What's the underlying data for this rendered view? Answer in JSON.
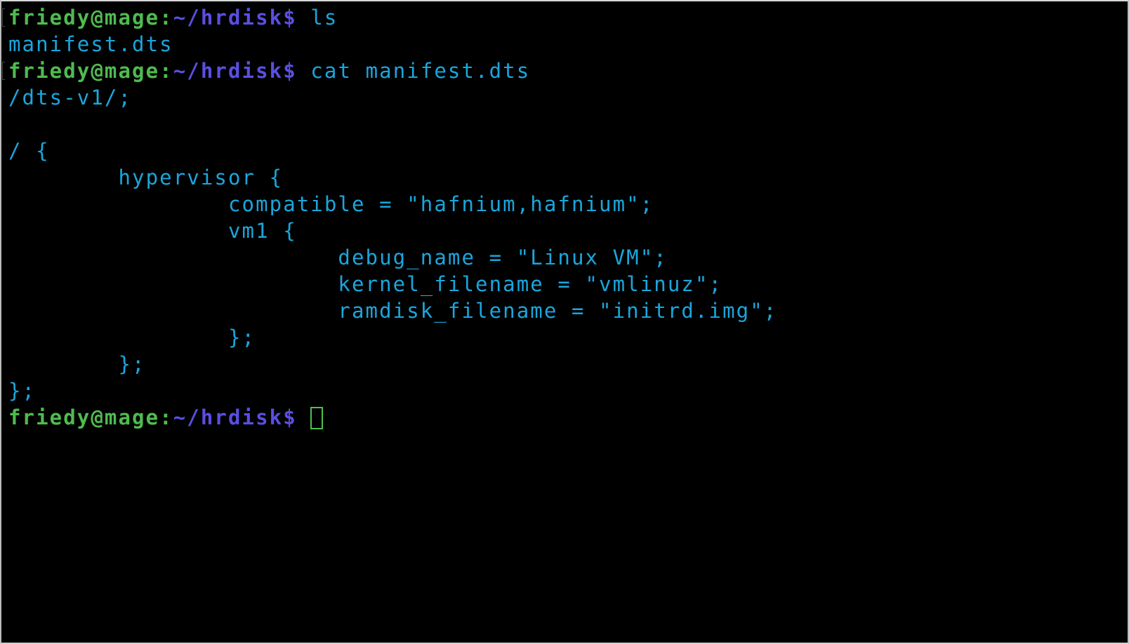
{
  "colors": {
    "background": "#000000",
    "user_host": "#4fbb4f",
    "path": "#5a4fe0",
    "output": "#1aa6dc",
    "cursor": "#4ec04e"
  },
  "prompt": {
    "user": "friedy",
    "at": "@",
    "host": "mage",
    "colon": ":",
    "path": "~/hrdisk",
    "symbol": "$"
  },
  "session": [
    {
      "type": "command",
      "command": " ls",
      "mark": true
    },
    {
      "type": "output",
      "text": "manifest.dts"
    },
    {
      "type": "command",
      "command": " cat manifest.dts",
      "mark": true
    },
    {
      "type": "output",
      "text": "/dts-v1/;"
    },
    {
      "type": "output",
      "text": ""
    },
    {
      "type": "output",
      "text": "/ {"
    },
    {
      "type": "output",
      "text": "        hypervisor {"
    },
    {
      "type": "output",
      "text": "                compatible = \"hafnium,hafnium\";"
    },
    {
      "type": "output",
      "text": "                vm1 {"
    },
    {
      "type": "output",
      "text": "                        debug_name = \"Linux VM\";"
    },
    {
      "type": "output",
      "text": "                        kernel_filename = \"vmlinuz\";"
    },
    {
      "type": "output",
      "text": "                        ramdisk_filename = \"initrd.img\";"
    },
    {
      "type": "output",
      "text": "                };"
    },
    {
      "type": "output",
      "text": "        };"
    },
    {
      "type": "output",
      "text": "};"
    },
    {
      "type": "command",
      "command": " ",
      "mark": false,
      "cursor": true
    }
  ]
}
